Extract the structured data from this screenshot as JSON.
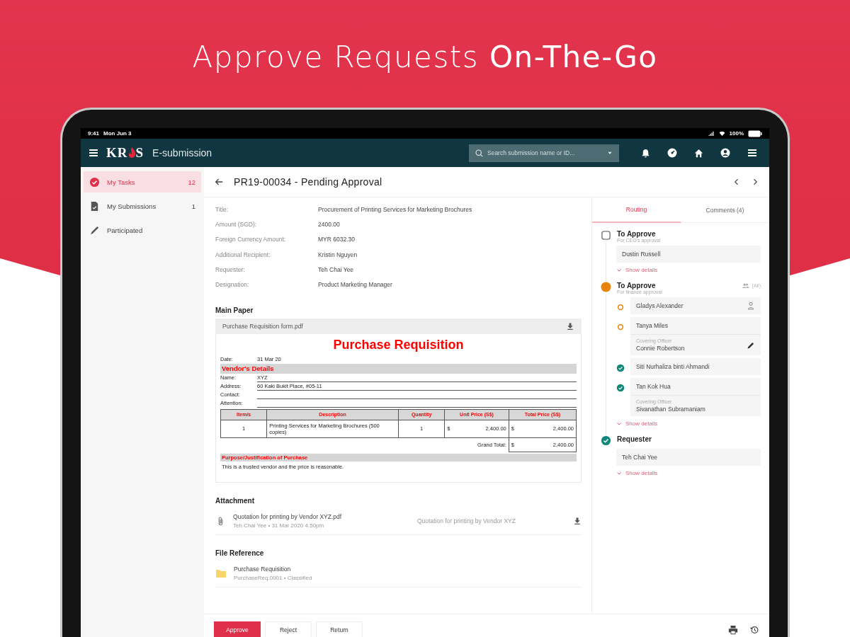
{
  "headline": "Approve Requests **On-The-Go**",
  "status_bar": {
    "time": "9:41",
    "date": "Mon Jun 3",
    "battery": "100%"
  },
  "header": {
    "logo": [
      "KR",
      "S"
    ],
    "app_name": "E-submission",
    "search": {
      "placeholder": "Search submission name or ID..."
    }
  },
  "sidebar": {
    "items": [
      {
        "label": "My Tasks",
        "count": "12",
        "selected": true
      },
      {
        "label": "My Submissions",
        "count": "1",
        "selected": false
      },
      {
        "label": "Participated",
        "selected": false
      }
    ]
  },
  "page_title": "PR19-00034 - Pending Approval",
  "fields": [
    {
      "label": "Title:",
      "value": "Procurement of Printing Services for Marketing Brochures"
    },
    {
      "label": "Amount (SGD):",
      "value": "2400.00"
    },
    {
      "label": "Foreign Currency Amount:",
      "value": "MYR 6032.30"
    },
    {
      "label": "Additional Recipient:",
      "value": "Kristin Nguyen"
    },
    {
      "label": "Requester:",
      "value": "Teh Chai Yee"
    },
    {
      "label": "Designation:",
      "value": "Product Marketing Manager"
    }
  ],
  "main_paper": {
    "title": "Main Paper",
    "file": "Purchase Requisition form.pdf",
    "document": {
      "heading": "Purchase Requisition",
      "date_label": "Date:",
      "date": "31 Mar 20",
      "vendor_heading": "Vendor's Details",
      "vendor": [
        {
          "label": "Name:",
          "value": "XYZ"
        },
        {
          "label": "Address:",
          "value": "60 Kaki Bukit Place, #05-11"
        },
        {
          "label": "Contact:"
        },
        {
          "label": "Attention:"
        }
      ],
      "columns": [
        "Item/s",
        "Description",
        "Quantity",
        "Unit Price (S$)",
        "Total Price (S$)"
      ],
      "rows": [
        {
          "item": "1",
          "description": "Printing Services for Marketing Brochures (500 copies)",
          "quantity": "1",
          "unit_currency": "$",
          "unit_price": "2,400.00",
          "total_currency": "$",
          "total_price": "2,400.00"
        }
      ],
      "grand_total_label": "Grand Total:",
      "grand_total_currency": "$",
      "grand_total": "2,400.00",
      "purpose_heading": "Purpose/Justification of Purchase",
      "purpose": "This is a trusted vendor and the price is reasonable."
    }
  },
  "attachment": {
    "title": "Attachment",
    "file": "Quotation for printing by Vendor XYZ.pdf",
    "meta": "Teh Chai Yee  •  31 Mar 2020  4:50pm",
    "description": "Quotation for printing by Vendor XYZ"
  },
  "file_reference": {
    "title": "File Reference",
    "name": "Purchase Requisition",
    "meta": "PurchaseReq.0001  •  Classified"
  },
  "actions": [
    {
      "label": "Approve",
      "kind": "primary"
    },
    {
      "label": "Reject",
      "kind": "secondary"
    },
    {
      "label": "Return",
      "kind": "secondary"
    }
  ],
  "panel_tabs": [
    {
      "label": "Routing",
      "selected": true
    },
    {
      "label": "Comments (4)",
      "selected": false
    }
  ],
  "steps": [
    {
      "kind": "pending",
      "title": "To Approve",
      "subtitle": "For CEO's approval",
      "approvers": [
        {
          "name": "Dustin Russell"
        }
      ],
      "show_details": "Show details"
    },
    {
      "kind": "current",
      "title": "To Approve",
      "subtitle": "For finance approval",
      "mode": "(All)",
      "approvers": [
        {
          "name": "Gladys Alexander",
          "kind": "pending",
          "delegate": true
        },
        {
          "name": "Tanya Miles",
          "kind": "pending",
          "covering_label": "Covering Officer",
          "covering": "Connie Robertson"
        },
        {
          "name": "Siti Nurhaliza binti Ahmandi",
          "kind": "approved"
        },
        {
          "name": "Tan Kok Hua",
          "kind": "approved",
          "covering_label": "Covering Officer",
          "covering": "Sivanathan Subramaniam"
        }
      ],
      "show_details": "Show details"
    },
    {
      "kind": "done",
      "title": "Requester",
      "approvers": [
        {
          "name": "Teh Chai Yee"
        }
      ],
      "show_details": "Show details"
    }
  ]
}
